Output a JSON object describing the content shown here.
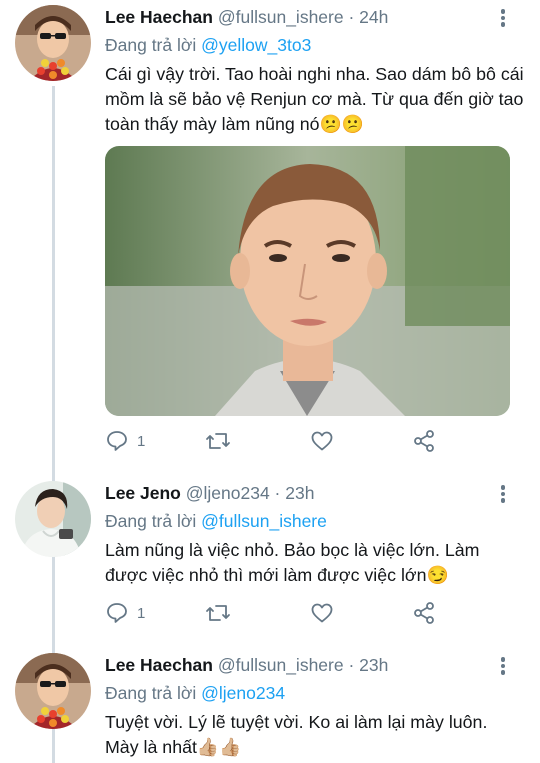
{
  "tweets": [
    {
      "name": "Lee Haechan",
      "handle": "@fullsun_ishere",
      "time": "24h",
      "reply_prefix": "Đang trả lời",
      "reply_to": "@yellow_3to3",
      "text": "Cái gì vậy trời. Tao hoài nghi nha. Sao dám bô bô cái mồm là sẽ bảo vệ Renjun cơ mà. Từ qua đến giờ tao toàn thấy mày làm nũng nó😕😕",
      "reply_count": "1",
      "icons": [
        "reply-icon",
        "retweet-icon",
        "like-icon",
        "share-icon"
      ]
    },
    {
      "name": "Lee Jeno",
      "handle": "@ljeno234",
      "time": "23h",
      "reply_prefix": "Đang trả lời",
      "reply_to": "@fullsun_ishere",
      "text": "Làm nũng là việc nhỏ. Bảo bọc là việc lớn. Làm được việc nhỏ thì mới làm được việc lớn😏",
      "reply_count": "1",
      "icons": [
        "reply-icon",
        "retweet-icon",
        "like-icon",
        "share-icon"
      ]
    },
    {
      "name": "Lee Haechan",
      "handle": "@fullsun_ishere",
      "time": "23h",
      "reply_prefix": "Đang trả lời",
      "reply_to": "@ljeno234",
      "text": "Tuyệt vời. Lý lẽ tuyệt vời. Ko ai làm lại mày luôn. Mày là nhất👍🏼👍🏼"
    }
  ],
  "separator": " · ",
  "colors": {
    "link": "#1da1f2",
    "secondary": "#657786",
    "thread_line": "#d3dbe2"
  }
}
